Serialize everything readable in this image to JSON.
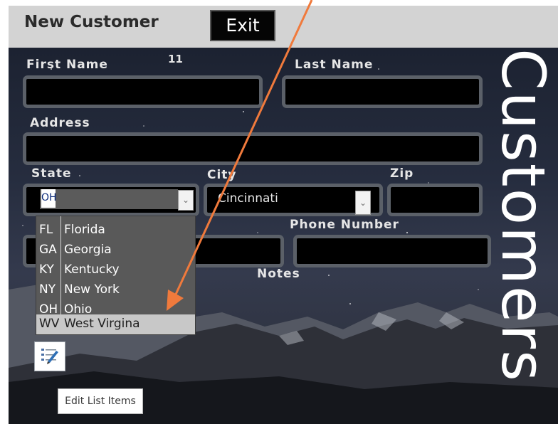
{
  "form": {
    "title": "New Customer",
    "exit_label": "Exit",
    "counter": "11",
    "watermark": "Customers"
  },
  "labels": {
    "first_name": "First Name",
    "last_name": "Last Name",
    "address": "Address",
    "state": "State",
    "city": "City",
    "zip": "Zip",
    "phone": "Phone Number",
    "notes": "Notes"
  },
  "fields": {
    "first_name": "",
    "last_name": "",
    "address": "",
    "state": "OH",
    "city": "Cincinnati",
    "zip": "",
    "phone": "",
    "email": "",
    "other": ""
  },
  "state_list": {
    "selected_index": 5,
    "options": [
      {
        "code": "FL",
        "name": "Florida"
      },
      {
        "code": "GA",
        "name": "Georgia"
      },
      {
        "code": "KY",
        "name": "Kentucky"
      },
      {
        "code": "NY",
        "name": "New York"
      },
      {
        "code": "OH",
        "name": "Ohio"
      },
      {
        "code": "WV",
        "name": "West Virgina"
      }
    ]
  },
  "tooltip": "Edit List Items",
  "icons": {
    "dropdown": "chevron-down-icon",
    "edit_list": "edit-list-icon"
  },
  "colors": {
    "title_bar": "#d3d3d3",
    "field_bg": "#000000",
    "field_border": "#5b6068",
    "annotation_arrow": "#f07a3c"
  }
}
